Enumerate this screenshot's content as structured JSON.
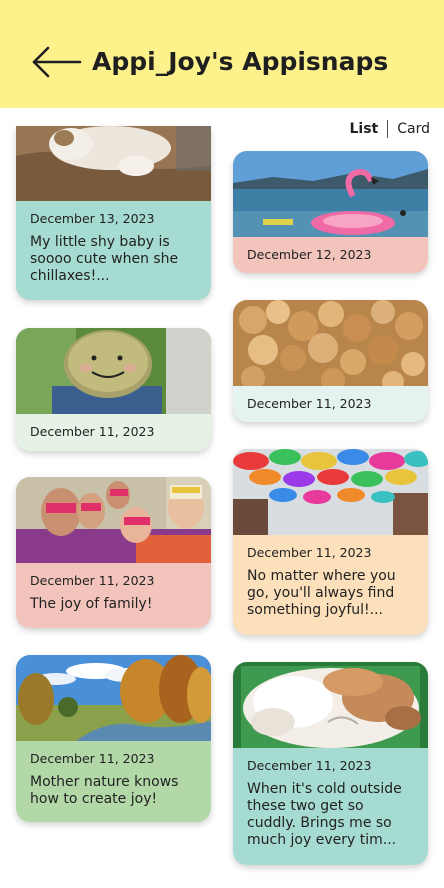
{
  "header": {
    "title": "Appi_Joy's Appisnaps",
    "back_icon": "arrow-left-icon",
    "background": "#fcf18b"
  },
  "view_toggle": {
    "list_label": "List",
    "card_label": "Card",
    "selected": "List"
  },
  "posts": [
    {
      "date": "December 13, 2023",
      "caption": "My little shy baby is soooo cute when she chillaxes!...",
      "image": "cat-sleeping-photo",
      "color": "#a6dbd1"
    },
    {
      "date": "December 12, 2023",
      "caption": "",
      "image": "flamingo-float-lake-photo",
      "color": "#f2c4bc"
    },
    {
      "date": "December 11, 2023",
      "caption": "",
      "image": "smiling-potato-pot-photo",
      "color": "#e6f2e6"
    },
    {
      "date": "December 11, 2023",
      "caption": "",
      "image": "caramel-popcorn-photo",
      "color": "#e4f2f0"
    },
    {
      "date": "December 11, 2023",
      "caption": "The joy of family!",
      "image": "family-masks-photo",
      "color": "#f2c4bc"
    },
    {
      "date": "December 11, 2023",
      "caption": "No matter where you go, you'll always find something joyful!...",
      "image": "umbrella-sky-photo",
      "color": "#fce0bc"
    },
    {
      "date": "December 11, 2023",
      "caption": "Mother nature knows how to create joy!",
      "image": "autumn-landscape-photo",
      "color": "#b3d8a8"
    },
    {
      "date": "December 11, 2023",
      "caption": "When it's cold outside these two get so cuddly.  Brings me so much joy every tim...",
      "image": "cats-cuddling-photo",
      "color": "#a6dbd1"
    }
  ]
}
